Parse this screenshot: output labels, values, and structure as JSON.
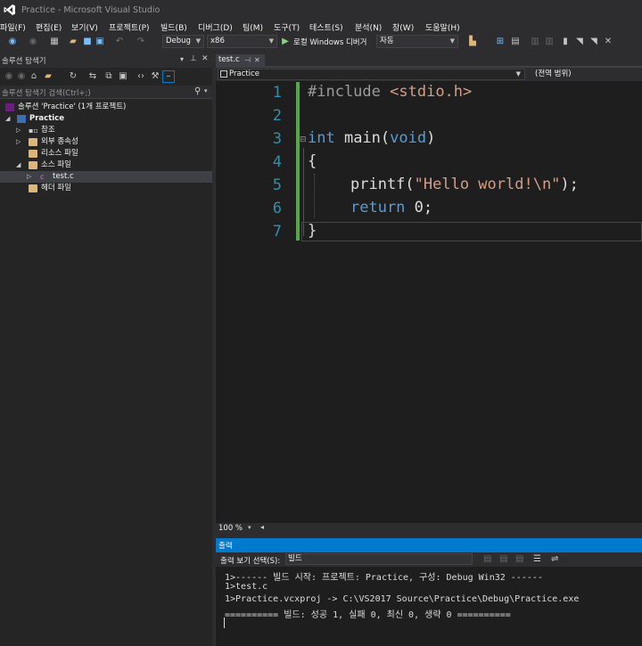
{
  "window": {
    "title": "Practice - Microsoft Visual Studio"
  },
  "menu": [
    "파일(F)",
    "편집(E)",
    "보기(V)",
    "프로젝트(P)",
    "빌드(B)",
    "디버그(D)",
    "팀(M)",
    "도구(T)",
    "테스트(S)",
    "분석(N)",
    "창(W)",
    "도움말(H)"
  ],
  "toolbar": {
    "config": "Debug",
    "platform": "x86",
    "run_label": "로컬 Windows 디버거",
    "run_mode": "자동"
  },
  "solution_explorer": {
    "title": "솔루션 탐색기",
    "search_placeholder": "솔루션 탐색기 검색(Ctrl+;)",
    "tree": [
      {
        "label": "솔루션 'Practice' (1개 프로젝트)",
        "level": 0
      },
      {
        "label": "Practice",
        "level": 0
      },
      {
        "label": "참조",
        "level": 1
      },
      {
        "label": "외부 종속성",
        "level": 1
      },
      {
        "label": "리소스 파일",
        "level": 1
      },
      {
        "label": "소스 파일",
        "level": 1
      },
      {
        "label": "test.c",
        "level": 2
      },
      {
        "label": "헤더 파일",
        "level": 1
      }
    ]
  },
  "editor": {
    "tab": "test.c",
    "nav_scope": "Practice",
    "nav_member": "(전역 범위)",
    "zoom": "100 %",
    "line_numbers": [
      "1",
      "2",
      "3",
      "4",
      "5",
      "6",
      "7"
    ],
    "code": {
      "l1_directive": "#include",
      "l1_header": "<stdio.h>",
      "l3_type": "int",
      "l3_rest": " main(",
      "l3_void": "void",
      "l3_close": ")",
      "l4": "{",
      "l5_fn": "printf(",
      "l5_str": "\"Hello world!\\n\"",
      "l5_end": ");",
      "l6_kw": "return",
      "l6_rest": " 0;",
      "l7": "}"
    },
    "colors": {
      "keyword": "#569cd6",
      "string": "#d69d85",
      "directive": "#9b9b9b",
      "line_number": "#2b91af",
      "change_bar": "#57a64a"
    }
  },
  "output": {
    "title": "출력",
    "show_from_label": "출력 보기 선택(S):",
    "show_from_value": "빌드",
    "lines": [
      "1>------ 빌드 시작: 프로젝트: Practice, 구성: Debug Win32 ------",
      "1>test.c",
      "1>Practice.vcxproj -> C:\\VS2017 Source\\Practice\\Debug\\Practice.exe",
      "========== 빌드: 성공 1, 실패 0, 최신 0, 생략 0 =========="
    ]
  }
}
